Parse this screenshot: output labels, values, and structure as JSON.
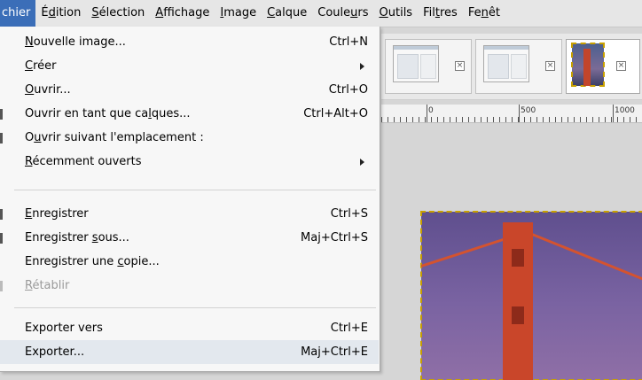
{
  "menubar": {
    "items": [
      {
        "pre": "",
        "u": "",
        "post": "chier"
      },
      {
        "pre": "É",
        "u": "d",
        "post": "ition"
      },
      {
        "pre": "",
        "u": "S",
        "post": "élection"
      },
      {
        "pre": "",
        "u": "A",
        "post": "ffichage"
      },
      {
        "pre": "",
        "u": "I",
        "post": "mage"
      },
      {
        "pre": "",
        "u": "C",
        "post": "alque"
      },
      {
        "pre": "Coule",
        "u": "u",
        "post": "rs"
      },
      {
        "pre": "",
        "u": "O",
        "post": "utils"
      },
      {
        "pre": "Fil",
        "u": "t",
        "post": "res"
      },
      {
        "pre": "Fe",
        "u": "n",
        "post": "êt"
      }
    ]
  },
  "menu": {
    "items": [
      {
        "pre": "",
        "u": "N",
        "post": "ouvelle image...",
        "shortcut": "Ctrl+N"
      },
      {
        "pre": "",
        "u": "C",
        "post": "réer",
        "shortcut": ""
      },
      {
        "pre": "",
        "u": "O",
        "post": "uvrir...",
        "shortcut": "Ctrl+O"
      },
      {
        "pre": "Ouvrir en tant que ca",
        "u": "l",
        "post": "ques...",
        "shortcut": "Ctrl+Alt+O"
      },
      {
        "pre": "O",
        "u": "u",
        "post": "vrir suivant l'emplacement :",
        "shortcut": ""
      },
      {
        "pre": "",
        "u": "R",
        "post": "écemment ouverts",
        "shortcut": ""
      },
      {
        "pre": "",
        "u": "E",
        "post": "nregistrer",
        "shortcut": "Ctrl+S"
      },
      {
        "pre": "Enregistrer ",
        "u": "s",
        "post": "ous...",
        "shortcut": "Maj+Ctrl+S"
      },
      {
        "pre": "Enregistrer une ",
        "u": "c",
        "post": "opie...",
        "shortcut": ""
      },
      {
        "pre": "",
        "u": "R",
        "post": "établir",
        "shortcut": ""
      },
      {
        "pre": "Exporter vers",
        "u": "",
        "post": "",
        "shortcut": "Ctrl+E"
      },
      {
        "pre": "Exporter...",
        "u": "",
        "post": "",
        "shortcut": "Maj+Ctrl+E"
      }
    ]
  },
  "ruler": {
    "labels": [
      "0",
      "500",
      "1000"
    ]
  },
  "icons": {
    "close": "close-icon",
    "submenu": "submenu-arrow-icon"
  }
}
